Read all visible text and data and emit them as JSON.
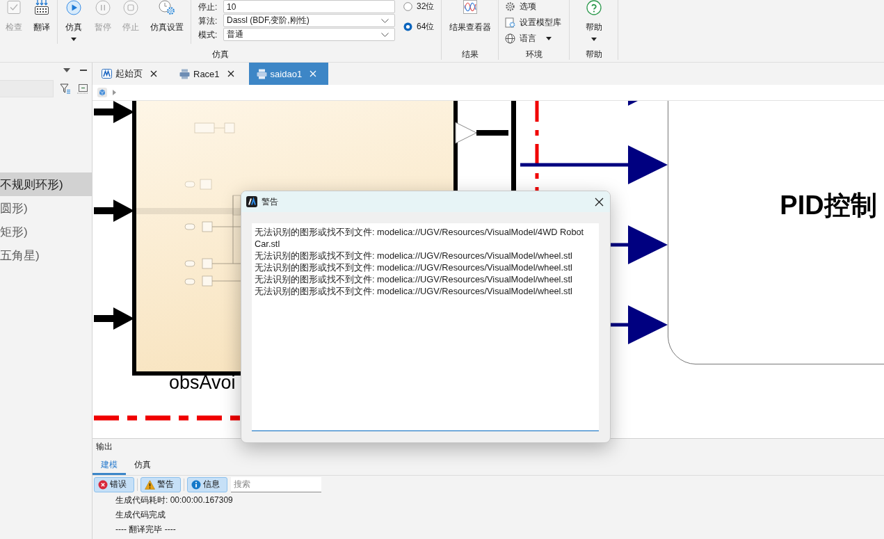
{
  "ribbon": {
    "groups": [
      {
        "label": "仿真",
        "buttons": [
          {
            "label": "检查",
            "disabled": true,
            "menu": false
          },
          {
            "label": "翻译",
            "disabled": false,
            "menu": false
          },
          {
            "label": "仿真",
            "disabled": false,
            "menu": true
          },
          {
            "label": "暂停",
            "disabled": true,
            "menu": false
          },
          {
            "label": "停止",
            "disabled": true,
            "menu": false
          },
          {
            "label": "仿真设置",
            "disabled": false,
            "menu": false
          }
        ],
        "fields": [
          {
            "kind": "text",
            "label": "停止:",
            "value": "10"
          },
          {
            "kind": "select",
            "label": "算法:",
            "value": "Dassl (BDF,变阶,刚性)"
          },
          {
            "kind": "select",
            "label": "模式:",
            "value": "普通"
          }
        ],
        "radios": [
          {
            "label": "32位",
            "selected": false
          },
          {
            "label": "64位",
            "selected": true
          }
        ]
      },
      {
        "label": "结果",
        "buttons": [
          {
            "label": "结果查看器",
            "disabled": false,
            "menu": false
          }
        ]
      },
      {
        "label": "环境",
        "items": [
          {
            "label": "选项",
            "menu": false
          },
          {
            "label": "设置模型库",
            "menu": false
          },
          {
            "label": "语言",
            "menu": true
          }
        ]
      },
      {
        "label": "帮助",
        "buttons": [
          {
            "label": "帮助",
            "disabled": false,
            "menu": true
          }
        ]
      }
    ]
  },
  "left_panel": {
    "items": [
      {
        "label": "不规则环形)",
        "selected": true
      },
      {
        "label": "圆形)",
        "selected": false
      },
      {
        "label": "矩形)",
        "selected": false
      },
      {
        "label": "五角星)",
        "selected": false
      }
    ]
  },
  "editor": {
    "tabs": [
      {
        "kind": "home",
        "label": "起始页",
        "selected": false
      },
      {
        "kind": "model",
        "label": "Race1",
        "selected": false
      },
      {
        "kind": "model",
        "label": "saidao1",
        "selected": true
      }
    ],
    "diagram": {
      "subsystem_label": "obsAvoi",
      "controller_label": "PID控制"
    }
  },
  "output": {
    "title": "输出",
    "tabs": [
      {
        "label": "建模",
        "selected": true
      },
      {
        "label": "仿真",
        "selected": false
      }
    ],
    "filters": [
      {
        "kind": "error",
        "label": "错误",
        "selected": true
      },
      {
        "kind": "warning",
        "label": "警告",
        "selected": true
      },
      {
        "kind": "info",
        "label": "信息",
        "selected": true
      }
    ],
    "search": {
      "placeholder": "搜索"
    },
    "lines": [
      "生成代码耗时: 00:00:00.167309",
      "生成代码完成",
      "---- 翻译完毕 ----"
    ]
  },
  "dialog": {
    "title": "警告",
    "messages": [
      "无法识别的图形或找不到文件: modelica://UGV/Resources/VisualModel/4WD Robot Car.stl",
      "无法识别的图形或找不到文件: modelica://UGV/Resources/VisualModel/wheel.stl",
      "无法识别的图形或找不到文件: modelica://UGV/Resources/VisualModel/wheel.stl",
      "无法识别的图形或找不到文件: modelica://UGV/Resources/VisualModel/wheel.stl",
      "无法识别的图形或找不到文件: modelica://UGV/Resources/VisualModel/wheel.stl"
    ]
  }
}
